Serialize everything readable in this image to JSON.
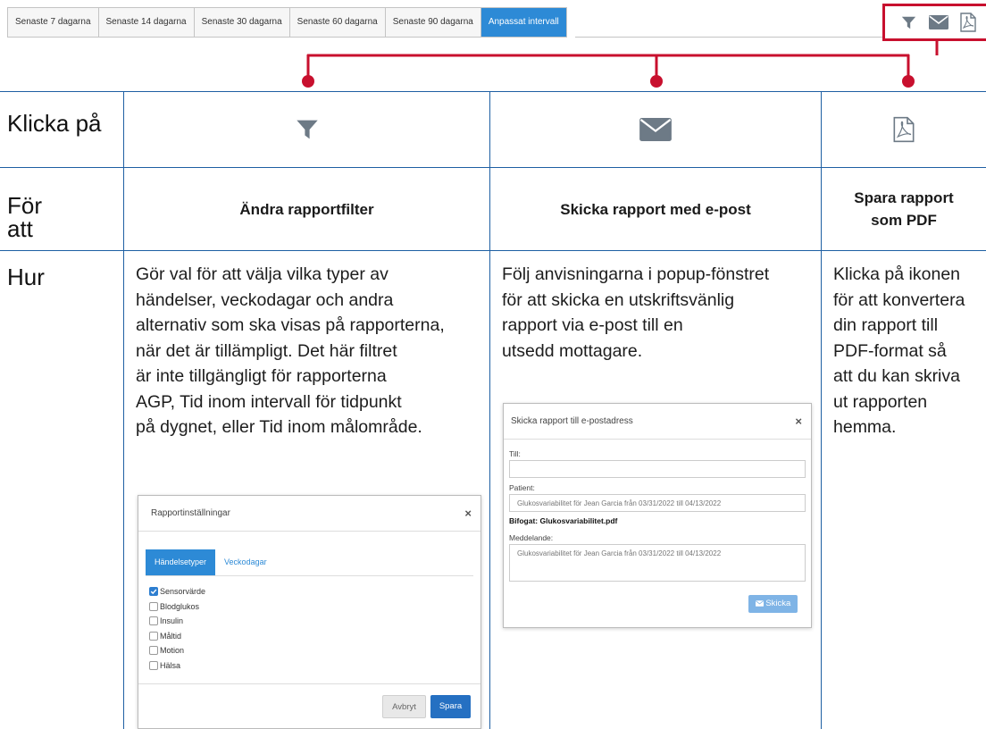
{
  "toolbar": {
    "ranges": [
      {
        "label": "Senaste 7 dagarna",
        "active": false
      },
      {
        "label": "Senaste 14 dagarna",
        "active": false
      },
      {
        "label": "Senaste 30 dagarna",
        "active": false
      },
      {
        "label": "Senaste 60 dagarna",
        "active": false
      },
      {
        "label": "Senaste 90 dagarna",
        "active": false
      },
      {
        "label": "Anpassat intervall",
        "active": true
      }
    ],
    "icons": [
      "filter-icon",
      "envelope-icon",
      "pdf-icon"
    ]
  },
  "colors": {
    "accent": "#2d8ad6",
    "callout": "#c8102e",
    "table_border": "#1e5fa3",
    "icon": "#6d7a86"
  },
  "table": {
    "row_labels": {
      "click": "Klicka på",
      "purpose": "För att",
      "how": "Hur"
    },
    "columns": [
      {
        "icon": "filter-icon",
        "title": "Ändra rapportfilter",
        "desc_lines": [
          "Gör val för att välja vilka typer av",
          "händelser, veckodagar och andra",
          "alternativ som ska visas på rapporterna,",
          "när det är tillämpligt. Det här filtret",
          "är inte tillgängligt för rapporterna",
          "AGP, Tid inom intervall för tidpunkt",
          "på dygnet, eller Tid inom målområde."
        ]
      },
      {
        "icon": "envelope-icon",
        "title": "Skicka rapport med e-post",
        "desc_lines": [
          "Följ anvisningarna i popup-fönstret",
          "för att skicka en utskriftsvänlig",
          "rapport via e-post till en",
          "utsedd mottagare."
        ]
      },
      {
        "icon": "pdf-icon",
        "title_lines": [
          "Spara rapport",
          "som PDF"
        ],
        "desc_lines": [
          "Klicka på ikonen",
          "för att konvertera",
          "din rapport till",
          "PDF-format så",
          "att du kan skriva",
          "ut rapporten",
          "hemma."
        ]
      }
    ]
  },
  "settings_dialog": {
    "title": "Rapportinställningar",
    "close": "×",
    "tabs": [
      {
        "label": "Händelsetyper",
        "active": true
      },
      {
        "label": "Veckodagar",
        "active": false
      }
    ],
    "options": [
      {
        "label": "Sensorvärde",
        "checked": true
      },
      {
        "label": "Blodglukos",
        "checked": false
      },
      {
        "label": "Insulin",
        "checked": false
      },
      {
        "label": "Måltid",
        "checked": false
      },
      {
        "label": "Motion",
        "checked": false
      },
      {
        "label": "Hälsa",
        "checked": false
      }
    ],
    "cancel_label": "Avbryt",
    "save_label": "Spara"
  },
  "email_dialog": {
    "title": "Skicka rapport till e-postadress",
    "close": "×",
    "to_label": "Till:",
    "to_value": "",
    "patient_label": "Patient:",
    "patient_value": "Glukosvariabilitet för Jean Garcia från 03/31/2022 till 04/13/2022",
    "attached_label": "Bifogat:",
    "attached_value": "Glukosvariabilitet.pdf",
    "message_label": "Meddelande:",
    "message_value": "Glukosvariabilitet för Jean Garcia från 03/31/2022 till 04/13/2022",
    "send_label": "Skicka"
  }
}
